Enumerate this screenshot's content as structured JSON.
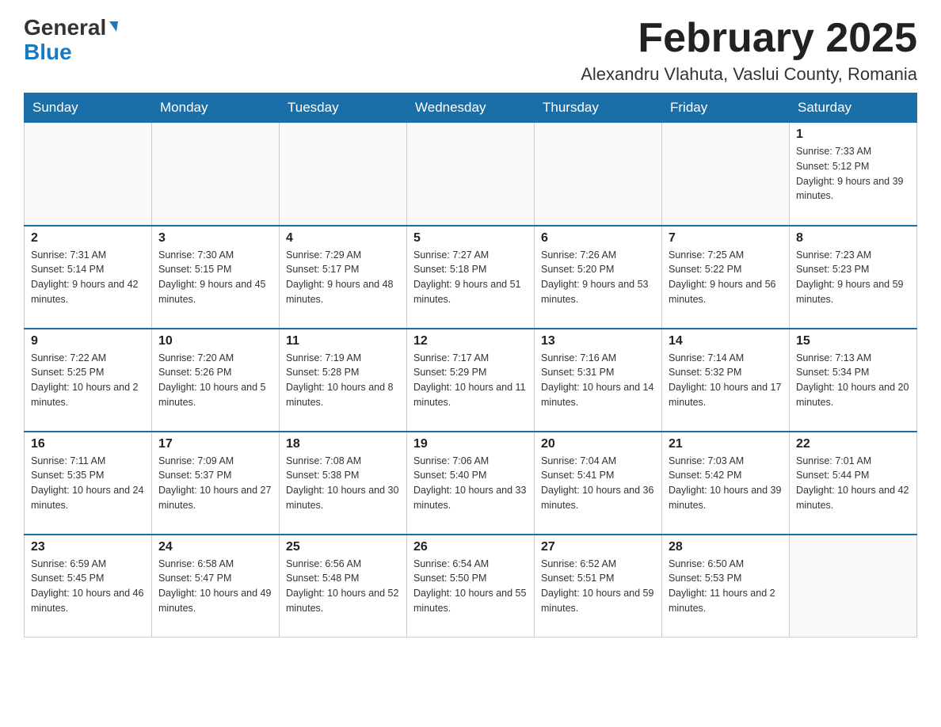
{
  "logo": {
    "general": "General",
    "blue": "Blue",
    "arrow": "▼"
  },
  "header": {
    "title": "February 2025",
    "location": "Alexandru Vlahuta, Vaslui County, Romania"
  },
  "days_of_week": [
    "Sunday",
    "Monday",
    "Tuesday",
    "Wednesday",
    "Thursday",
    "Friday",
    "Saturday"
  ],
  "weeks": [
    [
      {
        "day": "",
        "sunrise": "",
        "sunset": "",
        "daylight": "",
        "empty": true
      },
      {
        "day": "",
        "sunrise": "",
        "sunset": "",
        "daylight": "",
        "empty": true
      },
      {
        "day": "",
        "sunrise": "",
        "sunset": "",
        "daylight": "",
        "empty": true
      },
      {
        "day": "",
        "sunrise": "",
        "sunset": "",
        "daylight": "",
        "empty": true
      },
      {
        "day": "",
        "sunrise": "",
        "sunset": "",
        "daylight": "",
        "empty": true
      },
      {
        "day": "",
        "sunrise": "",
        "sunset": "",
        "daylight": "",
        "empty": true
      },
      {
        "day": "1",
        "sunrise": "Sunrise: 7:33 AM",
        "sunset": "Sunset: 5:12 PM",
        "daylight": "Daylight: 9 hours and 39 minutes.",
        "empty": false
      }
    ],
    [
      {
        "day": "2",
        "sunrise": "Sunrise: 7:31 AM",
        "sunset": "Sunset: 5:14 PM",
        "daylight": "Daylight: 9 hours and 42 minutes.",
        "empty": false
      },
      {
        "day": "3",
        "sunrise": "Sunrise: 7:30 AM",
        "sunset": "Sunset: 5:15 PM",
        "daylight": "Daylight: 9 hours and 45 minutes.",
        "empty": false
      },
      {
        "day": "4",
        "sunrise": "Sunrise: 7:29 AM",
        "sunset": "Sunset: 5:17 PM",
        "daylight": "Daylight: 9 hours and 48 minutes.",
        "empty": false
      },
      {
        "day": "5",
        "sunrise": "Sunrise: 7:27 AM",
        "sunset": "Sunset: 5:18 PM",
        "daylight": "Daylight: 9 hours and 51 minutes.",
        "empty": false
      },
      {
        "day": "6",
        "sunrise": "Sunrise: 7:26 AM",
        "sunset": "Sunset: 5:20 PM",
        "daylight": "Daylight: 9 hours and 53 minutes.",
        "empty": false
      },
      {
        "day": "7",
        "sunrise": "Sunrise: 7:25 AM",
        "sunset": "Sunset: 5:22 PM",
        "daylight": "Daylight: 9 hours and 56 minutes.",
        "empty": false
      },
      {
        "day": "8",
        "sunrise": "Sunrise: 7:23 AM",
        "sunset": "Sunset: 5:23 PM",
        "daylight": "Daylight: 9 hours and 59 minutes.",
        "empty": false
      }
    ],
    [
      {
        "day": "9",
        "sunrise": "Sunrise: 7:22 AM",
        "sunset": "Sunset: 5:25 PM",
        "daylight": "Daylight: 10 hours and 2 minutes.",
        "empty": false
      },
      {
        "day": "10",
        "sunrise": "Sunrise: 7:20 AM",
        "sunset": "Sunset: 5:26 PM",
        "daylight": "Daylight: 10 hours and 5 minutes.",
        "empty": false
      },
      {
        "day": "11",
        "sunrise": "Sunrise: 7:19 AM",
        "sunset": "Sunset: 5:28 PM",
        "daylight": "Daylight: 10 hours and 8 minutes.",
        "empty": false
      },
      {
        "day": "12",
        "sunrise": "Sunrise: 7:17 AM",
        "sunset": "Sunset: 5:29 PM",
        "daylight": "Daylight: 10 hours and 11 minutes.",
        "empty": false
      },
      {
        "day": "13",
        "sunrise": "Sunrise: 7:16 AM",
        "sunset": "Sunset: 5:31 PM",
        "daylight": "Daylight: 10 hours and 14 minutes.",
        "empty": false
      },
      {
        "day": "14",
        "sunrise": "Sunrise: 7:14 AM",
        "sunset": "Sunset: 5:32 PM",
        "daylight": "Daylight: 10 hours and 17 minutes.",
        "empty": false
      },
      {
        "day": "15",
        "sunrise": "Sunrise: 7:13 AM",
        "sunset": "Sunset: 5:34 PM",
        "daylight": "Daylight: 10 hours and 20 minutes.",
        "empty": false
      }
    ],
    [
      {
        "day": "16",
        "sunrise": "Sunrise: 7:11 AM",
        "sunset": "Sunset: 5:35 PM",
        "daylight": "Daylight: 10 hours and 24 minutes.",
        "empty": false
      },
      {
        "day": "17",
        "sunrise": "Sunrise: 7:09 AM",
        "sunset": "Sunset: 5:37 PM",
        "daylight": "Daylight: 10 hours and 27 minutes.",
        "empty": false
      },
      {
        "day": "18",
        "sunrise": "Sunrise: 7:08 AM",
        "sunset": "Sunset: 5:38 PM",
        "daylight": "Daylight: 10 hours and 30 minutes.",
        "empty": false
      },
      {
        "day": "19",
        "sunrise": "Sunrise: 7:06 AM",
        "sunset": "Sunset: 5:40 PM",
        "daylight": "Daylight: 10 hours and 33 minutes.",
        "empty": false
      },
      {
        "day": "20",
        "sunrise": "Sunrise: 7:04 AM",
        "sunset": "Sunset: 5:41 PM",
        "daylight": "Daylight: 10 hours and 36 minutes.",
        "empty": false
      },
      {
        "day": "21",
        "sunrise": "Sunrise: 7:03 AM",
        "sunset": "Sunset: 5:42 PM",
        "daylight": "Daylight: 10 hours and 39 minutes.",
        "empty": false
      },
      {
        "day": "22",
        "sunrise": "Sunrise: 7:01 AM",
        "sunset": "Sunset: 5:44 PM",
        "daylight": "Daylight: 10 hours and 42 minutes.",
        "empty": false
      }
    ],
    [
      {
        "day": "23",
        "sunrise": "Sunrise: 6:59 AM",
        "sunset": "Sunset: 5:45 PM",
        "daylight": "Daylight: 10 hours and 46 minutes.",
        "empty": false
      },
      {
        "day": "24",
        "sunrise": "Sunrise: 6:58 AM",
        "sunset": "Sunset: 5:47 PM",
        "daylight": "Daylight: 10 hours and 49 minutes.",
        "empty": false
      },
      {
        "day": "25",
        "sunrise": "Sunrise: 6:56 AM",
        "sunset": "Sunset: 5:48 PM",
        "daylight": "Daylight: 10 hours and 52 minutes.",
        "empty": false
      },
      {
        "day": "26",
        "sunrise": "Sunrise: 6:54 AM",
        "sunset": "Sunset: 5:50 PM",
        "daylight": "Daylight: 10 hours and 55 minutes.",
        "empty": false
      },
      {
        "day": "27",
        "sunrise": "Sunrise: 6:52 AM",
        "sunset": "Sunset: 5:51 PM",
        "daylight": "Daylight: 10 hours and 59 minutes.",
        "empty": false
      },
      {
        "day": "28",
        "sunrise": "Sunrise: 6:50 AM",
        "sunset": "Sunset: 5:53 PM",
        "daylight": "Daylight: 11 hours and 2 minutes.",
        "empty": false
      },
      {
        "day": "",
        "sunrise": "",
        "sunset": "",
        "daylight": "",
        "empty": true
      }
    ]
  ]
}
